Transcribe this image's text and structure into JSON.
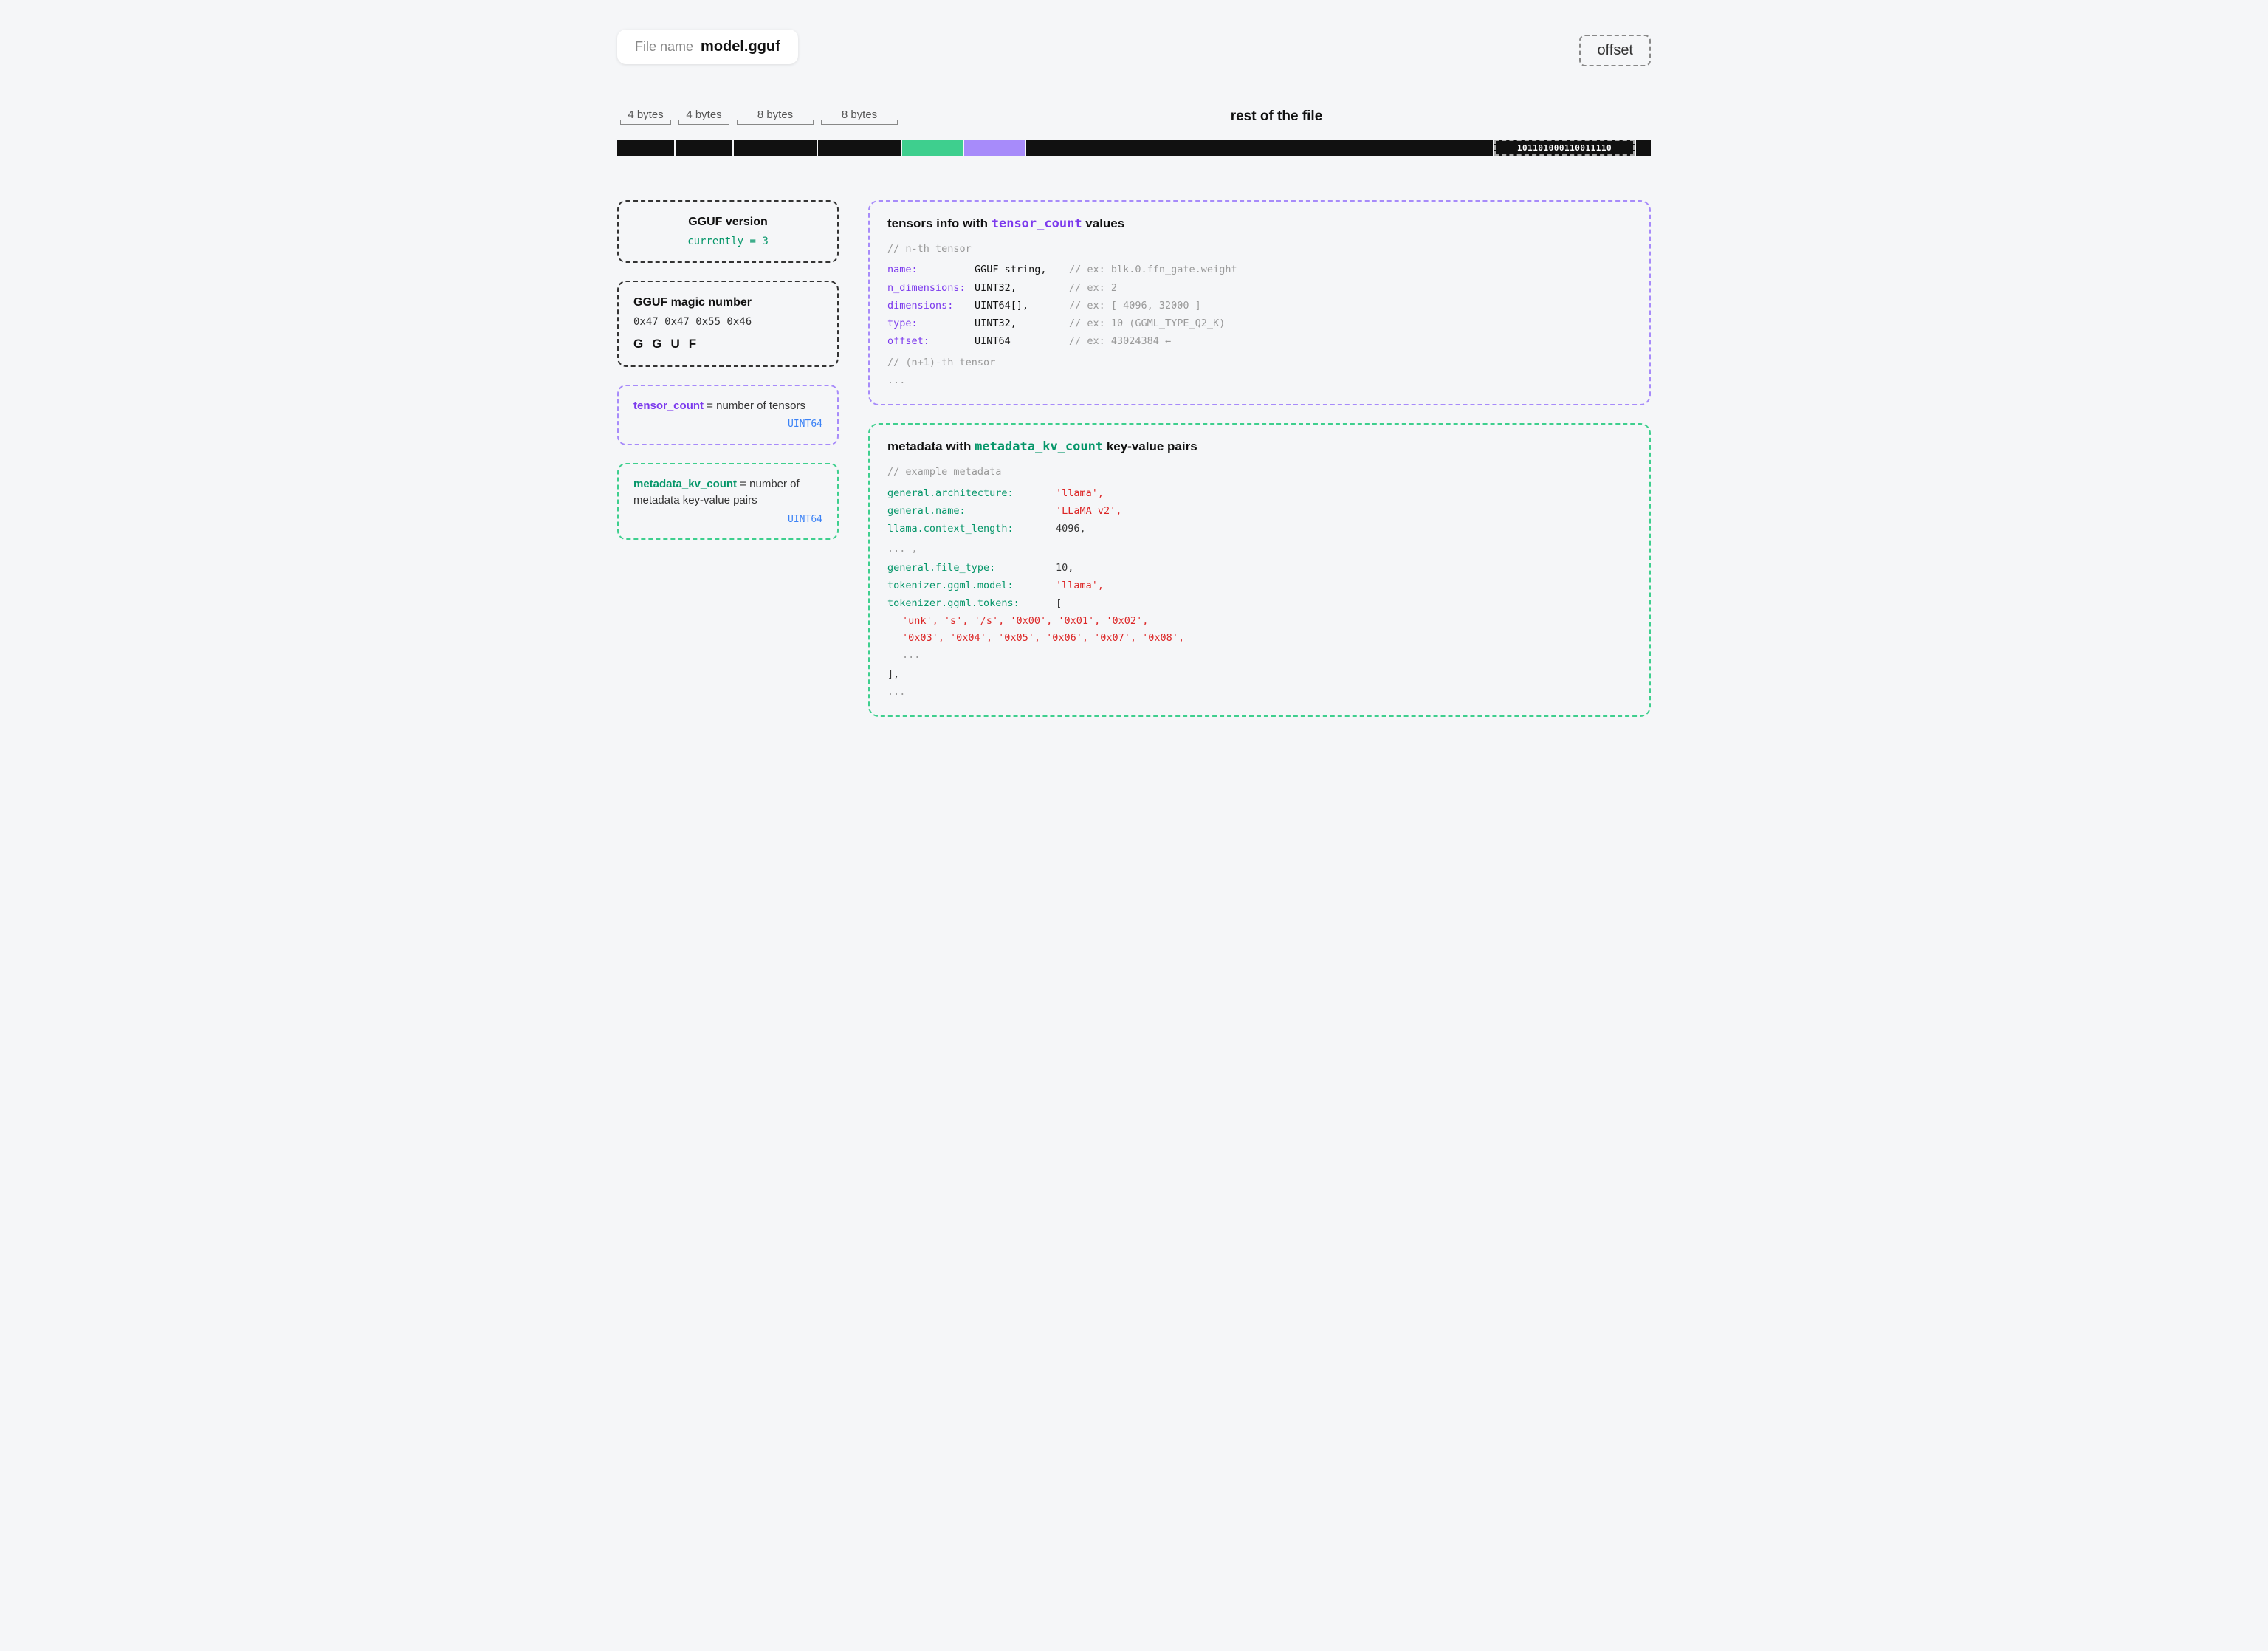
{
  "header": {
    "file_label": "File name",
    "file_name": "model.gguf"
  },
  "bar": {
    "segments": [
      {
        "id": "seg1",
        "type": "black",
        "label": "4 bytes"
      },
      {
        "id": "seg2",
        "type": "black",
        "label": "4 bytes"
      },
      {
        "id": "seg3",
        "type": "black",
        "label": "8 bytes"
      },
      {
        "id": "seg4",
        "type": "black",
        "label": "8 bytes"
      },
      {
        "id": "seg5",
        "type": "green"
      },
      {
        "id": "seg6",
        "type": "purple"
      },
      {
        "id": "seg7",
        "type": "black-rest"
      },
      {
        "id": "seg8",
        "type": "bits",
        "value": "101101000110011110"
      }
    ],
    "rest_label": "rest of the file",
    "offset_label": "offset"
  },
  "left_boxes": {
    "magic_box": {
      "title": "GGUF magic number",
      "hex": "0x47 0x47 0x55 0x46",
      "letters": [
        "G",
        "G",
        "U",
        "F"
      ]
    },
    "version_box": {
      "label": "GGUF version",
      "current": "currently = 3"
    },
    "tensor_count_box": {
      "text_purple": "tensor_count",
      "text_suffix": " = number of tensors",
      "type_label": "UINT64"
    },
    "metadata_count_box": {
      "text_green": "metadata_kv_count",
      "text_suffix": " = number of metadata key-value pairs",
      "type_label": "UINT64"
    }
  },
  "tensor_info_box": {
    "title": "tensors info with ",
    "title_mono": "tensor_count",
    "title_suffix": " values",
    "comment1": "// n-th tensor",
    "rows": [
      {
        "key": "name:",
        "type": "GGUF string,",
        "comment": "// ex: blk.0.ffn_gate.weight"
      },
      {
        "key": "n_dimensions:",
        "type": "UINT32,",
        "comment": "// ex: 2"
      },
      {
        "key": "dimensions:",
        "type": "UINT64[],",
        "comment": "// ex: [ 4096, 32000 ]"
      },
      {
        "key": "type:",
        "type": "UINT32,",
        "comment": "// ex: 10 (GGML_TYPE_Q2_K)"
      },
      {
        "key": "offset:",
        "type": "UINT64",
        "comment": "// ex: 43024384 ←"
      }
    ],
    "comment2": "// (n+1)-th tensor",
    "ellipsis": "..."
  },
  "metadata_box": {
    "title": "metadata with ",
    "title_mono": "metadata_kv_count",
    "title_suffix": " key-value pairs",
    "comment": "// example metadata",
    "lines": [
      {
        "key": "general.architecture:",
        "value": "'llama',"
      },
      {
        "key": "general.name:",
        "value": "'LLaMA v2',"
      },
      {
        "key": "llama.context_length:",
        "value": "4096,"
      },
      {
        "key": "... ,",
        "value": ""
      },
      {
        "key": "general.file_type:",
        "value": "10,"
      },
      {
        "key": "tokenizer.ggml.model:",
        "value": "'llama',"
      },
      {
        "key": "tokenizer.ggml.tokens:",
        "value": "["
      }
    ],
    "token_lines": [
      "  '<unk>',  '<s>',     '</s>',    '<0x00>', '<0x01>', '<0x02>',",
      "  '<0x03>', '<0x04>',  '<0x05>',  '<0x06>', '<0x07>', '<0x08>',",
      "  ..."
    ],
    "closing": "],",
    "final_ellipsis": "..."
  }
}
